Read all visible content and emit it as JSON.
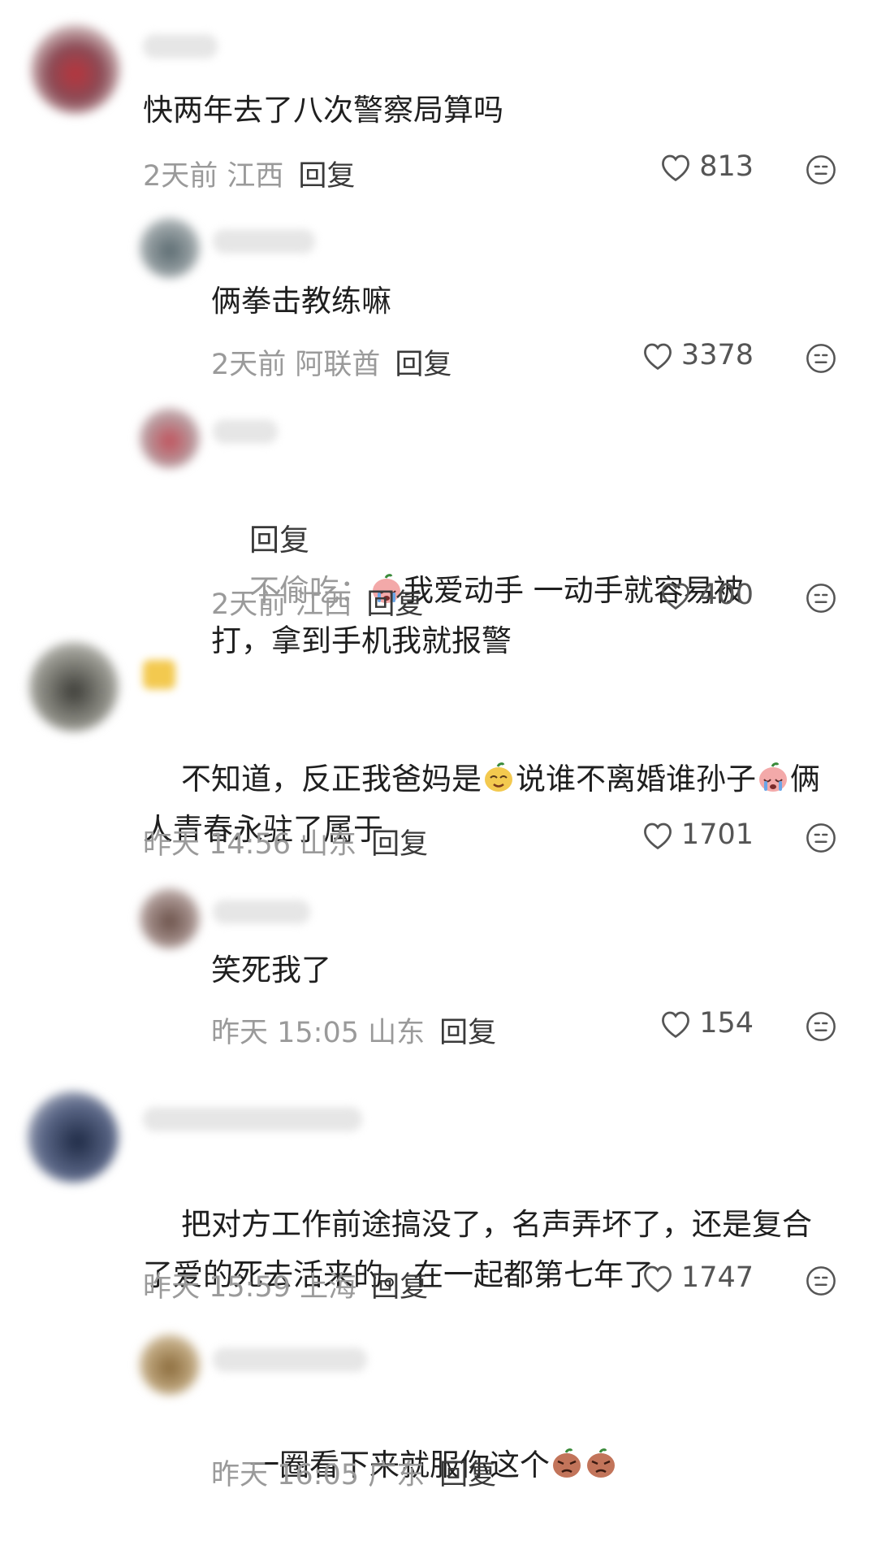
{
  "comments": [
    {
      "text": "快两年去了八次警察局算吗",
      "time_loc": "2天前 江西",
      "reply": "回复",
      "likes": "813"
    },
    {
      "text": "俩拳击教练嘛",
      "time_loc": "2天前 阿联酋",
      "reply": "回复",
      "likes": "3378"
    },
    {
      "prefix": "回复",
      "reply_to": "不偷吃：",
      "text_a": "我爱动手 一动手就容易被",
      "text_b": "打，拿到手机我就报警",
      "time_loc": "2天前 江西",
      "reply": "回复",
      "likes": "400"
    },
    {
      "text_a1": "不知道，反正我爸妈是",
      "text_a2": "说谁不离婚谁孙子",
      "text_a3": "俩",
      "text_b": "人青春永驻了属于",
      "time_loc": "昨天 14:56 山东",
      "reply": "回复",
      "likes": "1701"
    },
    {
      "text": "笑死我了",
      "time_loc": "昨天 15:05 山东",
      "reply": "回复",
      "likes": "154"
    },
    {
      "text_a": "把对方工作前途搞没了，名声弄坏了，还是复合",
      "text_b": "了爱的死去活来的。在一起都第七年了",
      "time_loc": "昨天 15:59 上海",
      "reply": "回复",
      "likes": "1747"
    },
    {
      "text": "一圈看下来就服你这个",
      "time_loc": "昨天 16:05 广东",
      "reply": "回复"
    }
  ],
  "icons": {
    "like": "heart-outline-icon",
    "more": "smiley-face-icon"
  },
  "colors": {
    "meta": "#9a9a9a",
    "text": "#1f1f1f",
    "reply": "#3a3a3a"
  }
}
